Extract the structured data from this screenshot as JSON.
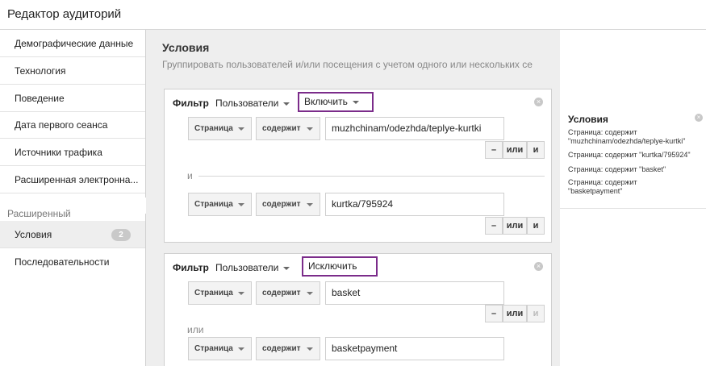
{
  "title": "Редактор аудиторий",
  "sidebar": {
    "items": [
      "Демографические данные",
      "Технология",
      "Поведение",
      "Дата первого сеанса",
      "Источники трафика",
      "Расширенная электронна..."
    ],
    "section": "Расширенный",
    "advanced": [
      {
        "label": "Условия",
        "badge": "2"
      },
      {
        "label": "Последовательности"
      }
    ]
  },
  "main": {
    "heading": "Условия",
    "subtitle": "Группировать пользователей и/или посещения с учетом одного или нескольких се",
    "filters": [
      {
        "label": "Фильтр",
        "scope": "Пользователи",
        "mode": "Включить",
        "rows": [
          {
            "dimension": "Страница",
            "operator": "содержит",
            "value": "muzhchinam/odezhda/teplye-kurtki"
          },
          {
            "dimension": "Страница",
            "operator": "содержит",
            "value": "kurtka/795924"
          }
        ],
        "joiner": "и"
      },
      {
        "label": "Фильтр",
        "scope": "Пользователи",
        "mode": "Исключить",
        "rows": [
          {
            "dimension": "Страница",
            "operator": "содержит",
            "value": "basket"
          },
          {
            "dimension": "Страница",
            "operator": "содержит",
            "value": "basketpayment"
          }
        ],
        "joiner": "или"
      }
    ],
    "buttons": {
      "minus": "–",
      "or": "или",
      "and": "и"
    }
  },
  "summary": {
    "title": "Условия",
    "lines": [
      "Страница: содержит",
      "\"muzhchinam/odezhda/teplye-kurtki\"",
      "Страница: содержит \"kurtka/795924\"",
      "Страница: содержит \"basket\"",
      "Страница: содержит",
      "\"basketpayment\""
    ]
  }
}
